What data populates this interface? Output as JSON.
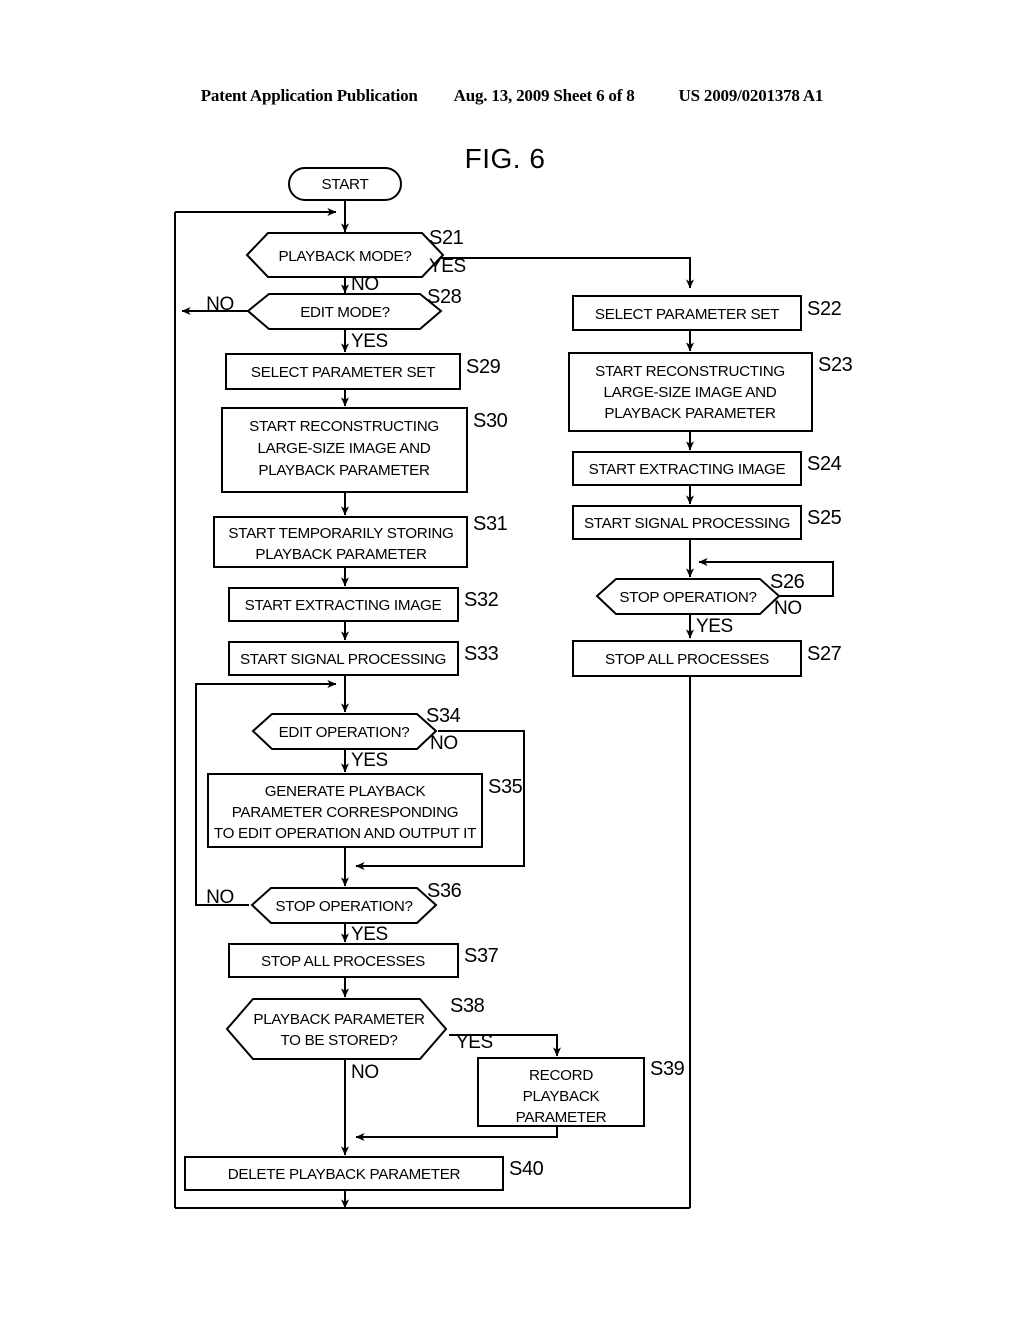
{
  "header": {
    "left": "Patent Application Publication",
    "center": "Aug. 13, 2009  Sheet 6 of 8",
    "right": "US 2009/0201378 A1"
  },
  "figure": {
    "title": "FIG. 6"
  },
  "chart_data": {
    "type": "diagram",
    "title": "FIG. 6",
    "nodes": [
      {
        "id": "START",
        "shape": "terminator",
        "label": "START",
        "step": ""
      },
      {
        "id": "S21",
        "shape": "decision",
        "label": "PLAYBACK MODE?",
        "step": "S21"
      },
      {
        "id": "S28",
        "shape": "decision",
        "label": "EDIT MODE?",
        "step": "S28"
      },
      {
        "id": "S29",
        "shape": "process",
        "label": "SELECT PARAMETER SET",
        "step": "S29"
      },
      {
        "id": "S30",
        "shape": "process",
        "label": "START RECONSTRUCTING\nLARGE-SIZE IMAGE AND\nPLAYBACK PARAMETER",
        "step": "S30"
      },
      {
        "id": "S31",
        "shape": "process",
        "label": "START TEMPORARILY STORING\nPLAYBACK PARAMETER",
        "step": "S31"
      },
      {
        "id": "S32",
        "shape": "process",
        "label": "START EXTRACTING IMAGE",
        "step": "S32"
      },
      {
        "id": "S33",
        "shape": "process",
        "label": "START SIGNAL PROCESSING",
        "step": "S33"
      },
      {
        "id": "S34",
        "shape": "decision",
        "label": "EDIT OPERATION?",
        "step": "S34"
      },
      {
        "id": "S35",
        "shape": "process",
        "label": "GENERATE PLAYBACK\nPARAMETER CORRESPONDING\nTO EDIT OPERATION AND OUTPUT IT",
        "step": "S35"
      },
      {
        "id": "S36",
        "shape": "decision",
        "label": "STOP OPERATION?",
        "step": "S36"
      },
      {
        "id": "S37",
        "shape": "process",
        "label": "STOP ALL PROCESSES",
        "step": "S37"
      },
      {
        "id": "S38",
        "shape": "decision",
        "label": "PLAYBACK PARAMETER\nTO BE STORED?",
        "step": "S38"
      },
      {
        "id": "S39",
        "shape": "process",
        "label": "RECORD\nPLAYBACK\nPARAMETER",
        "step": "S39"
      },
      {
        "id": "S40",
        "shape": "process",
        "label": "DELETE PLAYBACK PARAMETER",
        "step": "S40"
      },
      {
        "id": "S22",
        "shape": "process",
        "label": "SELECT PARAMETER SET",
        "step": "S22"
      },
      {
        "id": "S23",
        "shape": "process",
        "label": "START RECONSTRUCTING\nLARGE-SIZE IMAGE AND\nPLAYBACK PARAMETER",
        "step": "S23"
      },
      {
        "id": "S24",
        "shape": "process",
        "label": "START EXTRACTING IMAGE",
        "step": "S24"
      },
      {
        "id": "S25",
        "shape": "process",
        "label": "START SIGNAL PROCESSING",
        "step": "S25"
      },
      {
        "id": "S26",
        "shape": "decision",
        "label": "STOP OPERATION?",
        "step": "S26"
      },
      {
        "id": "S27",
        "shape": "process",
        "label": "STOP ALL PROCESSES",
        "step": "S27"
      }
    ],
    "edges": [
      {
        "from": "START",
        "to": "S21",
        "label": ""
      },
      {
        "from": "S21",
        "to": "S22",
        "label": "YES"
      },
      {
        "from": "S21",
        "to": "S28",
        "label": "NO"
      },
      {
        "from": "S28",
        "to": "S21",
        "label": "NO"
      },
      {
        "from": "S28",
        "to": "S29",
        "label": "YES"
      },
      {
        "from": "S29",
        "to": "S30",
        "label": ""
      },
      {
        "from": "S30",
        "to": "S31",
        "label": ""
      },
      {
        "from": "S31",
        "to": "S32",
        "label": ""
      },
      {
        "from": "S32",
        "to": "S33",
        "label": ""
      },
      {
        "from": "S33",
        "to": "S34",
        "label": ""
      },
      {
        "from": "S34",
        "to": "S35",
        "label": "YES"
      },
      {
        "from": "S34",
        "to": "S36",
        "label": "NO"
      },
      {
        "from": "S35",
        "to": "S36",
        "label": ""
      },
      {
        "from": "S36",
        "to": "S34",
        "label": "NO"
      },
      {
        "from": "S36",
        "to": "S37",
        "label": "YES"
      },
      {
        "from": "S37",
        "to": "S38",
        "label": ""
      },
      {
        "from": "S38",
        "to": "S39",
        "label": "YES"
      },
      {
        "from": "S38",
        "to": "S40",
        "label": "NO"
      },
      {
        "from": "S39",
        "to": "S40",
        "label": ""
      },
      {
        "from": "S40",
        "to": "S21",
        "label": ""
      },
      {
        "from": "S22",
        "to": "S23",
        "label": ""
      },
      {
        "from": "S23",
        "to": "S24",
        "label": ""
      },
      {
        "from": "S24",
        "to": "S25",
        "label": ""
      },
      {
        "from": "S25",
        "to": "S26",
        "label": ""
      },
      {
        "from": "S26",
        "to": "S25",
        "label": "NO"
      },
      {
        "from": "S26",
        "to": "S27",
        "label": "YES"
      },
      {
        "from": "S27",
        "to": "S21",
        "label": ""
      }
    ]
  },
  "labels": {
    "start": "START",
    "s21": "PLAYBACK MODE?",
    "s21_id": "S21",
    "s21_yes": "YES",
    "s21_no": "NO",
    "s28": "EDIT MODE?",
    "s28_id": "S28",
    "s28_no": "NO",
    "s28_yes": "YES",
    "s29": "SELECT PARAMETER SET",
    "s29_id": "S29",
    "s30_l1": "START RECONSTRUCTING",
    "s30_l2": "LARGE-SIZE IMAGE AND",
    "s30_l3": "PLAYBACK PARAMETER",
    "s30_id": "S30",
    "s31_l1": "START TEMPORARILY STORING",
    "s31_l2": "PLAYBACK PARAMETER",
    "s31_id": "S31",
    "s32": "START EXTRACTING IMAGE",
    "s32_id": "S32",
    "s33": "START SIGNAL PROCESSING",
    "s33_id": "S33",
    "s34": "EDIT OPERATION?",
    "s34_id": "S34",
    "s34_no": "NO",
    "s34_yes": "YES",
    "s35_l1": "GENERATE PLAYBACK",
    "s35_l2": "PARAMETER CORRESPONDING",
    "s35_l3": "TO EDIT OPERATION AND OUTPUT IT",
    "s35_id": "S35",
    "s36": "STOP OPERATION?",
    "s36_id": "S36",
    "s36_no": "NO",
    "s36_yes": "YES",
    "s37": "STOP ALL PROCESSES",
    "s37_id": "S37",
    "s38_l1": "PLAYBACK PARAMETER",
    "s38_l2": "TO BE STORED?",
    "s38_id": "S38",
    "s38_yes": "YES",
    "s38_no": "NO",
    "s39_l1": "RECORD",
    "s39_l2": "PLAYBACK",
    "s39_l3": "PARAMETER",
    "s39_id": "S39",
    "s40": "DELETE PLAYBACK PARAMETER",
    "s40_id": "S40",
    "s22": "SELECT PARAMETER SET",
    "s22_id": "S22",
    "s23_l1": "START RECONSTRUCTING",
    "s23_l2": "LARGE-SIZE IMAGE AND",
    "s23_l3": "PLAYBACK PARAMETER",
    "s23_id": "S23",
    "s24": "START EXTRACTING IMAGE",
    "s24_id": "S24",
    "s25": "START SIGNAL PROCESSING",
    "s25_id": "S25",
    "s26": "STOP OPERATION?",
    "s26_id": "S26",
    "s26_no": "NO",
    "s26_yes": "YES",
    "s27": "STOP ALL PROCESSES",
    "s27_id": "S27"
  }
}
